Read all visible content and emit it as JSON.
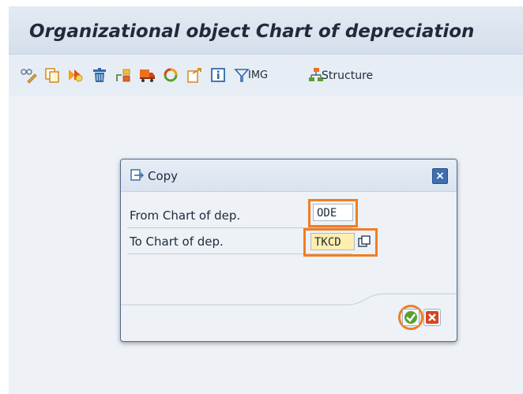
{
  "window": {
    "title": "Organizational object Chart of depreciation"
  },
  "toolbar": {
    "icons": [
      "display-change-icon",
      "copy-icon",
      "copy-org-object-icon",
      "delete-icon",
      "transport-icon",
      "truck-icon",
      "cycle-icon",
      "export-icon",
      "info-icon",
      "filter-icon"
    ],
    "img_label": "IMG",
    "structure_label": "Structure"
  },
  "dialog": {
    "title": "Copy",
    "close_label": "×",
    "from_label": "From Chart of dep.",
    "from_value": "ODE",
    "to_label": "To Chart of dep.",
    "to_value": "TKCD",
    "highlight_color": "#f07e23"
  }
}
